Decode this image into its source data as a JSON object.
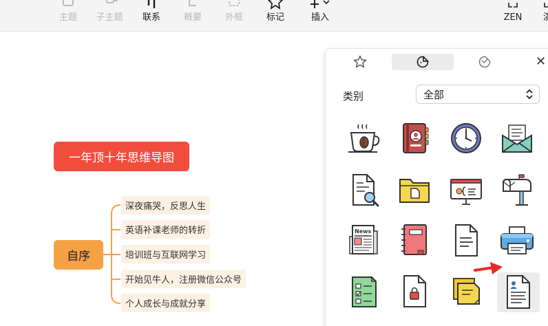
{
  "toolbar": {
    "items": [
      {
        "label": "主题",
        "icon": "topic-icon"
      },
      {
        "label": "子主题",
        "icon": "subtopic-icon"
      },
      {
        "label": "联系",
        "icon": "relationship-icon"
      },
      {
        "label": "概要",
        "icon": "summary-icon"
      },
      {
        "label": "外框",
        "icon": "boundary-icon"
      },
      {
        "label": "标记",
        "icon": "star-icon"
      },
      {
        "label": "插入",
        "icon": "plus-icon"
      },
      {
        "label": "ZEN",
        "icon": "zen-icon"
      },
      {
        "label": "演",
        "icon": "pitch-icon"
      }
    ]
  },
  "mindmap": {
    "central": "一年顶十年思维导图",
    "topic": "自序",
    "branches": [
      "深夜痛哭，反思人生",
      "英语补课老师的转折",
      "培训班与互联网学习",
      "开始见牛人，注册微信公众号",
      "个人成长与成就分享"
    ]
  },
  "panel": {
    "tabs": [
      "marker-star",
      "sticker",
      "illustration"
    ],
    "active_tab": 1,
    "category_label": "类别",
    "category_value": "全部",
    "stickers": [
      [
        "coffee-icon",
        "address-book-icon",
        "clock-icon",
        "envelope-icon"
      ],
      [
        "document-search-icon",
        "folder-icon",
        "presentation-board-icon",
        "mailbox-icon"
      ],
      [
        "newspaper-icon",
        "notebook-icon",
        "document-icon",
        "printer-icon"
      ],
      [
        "checklist-icon",
        "locked-file-icon",
        "sticky-notes-icon",
        "resume-icon"
      ]
    ],
    "selected_sticker": "resume-icon",
    "sticker_text": {
      "news": "News"
    }
  },
  "colors": {
    "central": "#f24c3d",
    "topic": "#f5a146",
    "branch_bg": "#fdf1e3",
    "connector": "#f5a146",
    "pointer_arrow": "#e32b2b"
  }
}
